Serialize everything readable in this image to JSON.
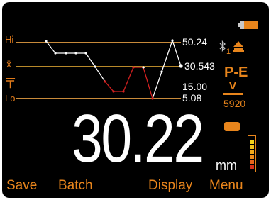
{
  "chart": {
    "hi_label": "Hi",
    "mean_label": "x̄",
    "nominal_label": "⊤",
    "lo_label": "Lo",
    "hi_value": "50.24",
    "mean_value": "30.543",
    "nominal_value": "15.00",
    "lo_value": "5.08"
  },
  "status": {
    "memory_index": "1",
    "mode": "P-E",
    "probe_mode": "V",
    "velocity": "5920"
  },
  "reading": {
    "value": "30.22",
    "unit": "mm"
  },
  "softkeys": {
    "save": "Save",
    "batch": "Batch",
    "display": "Display",
    "menu": "Menu"
  },
  "colors": {
    "accent": "#e8851c",
    "in_tolerance": "#ffffff",
    "out_of_tolerance": "#d42020",
    "hi_lo_line": "#c88a3a",
    "nominal_line": "#d01818",
    "mean_line": "#b8892a"
  },
  "icons": {
    "battery": "battery-icon",
    "bluetooth": "bluetooth-icon",
    "memory": "memory-upload-icon",
    "gate": "gate-icon",
    "signal": "signal-strength-icon"
  }
}
